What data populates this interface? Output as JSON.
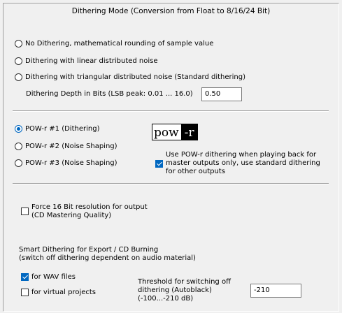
{
  "dithering": {
    "title": "Dithering Mode (Conversion from Float to 8/16/24 Bit)",
    "option_none": "No Dithering, mathematical rounding of sample value",
    "option_linear": "Dithering with linear distributed noise",
    "option_triangular": "Dithering with triangular distributed noise (Standard dithering)",
    "depth_label": "Dithering Depth in Bits (LSB peak: 0.01 ... 16.0)",
    "depth_value": "0.50",
    "selected": "none"
  },
  "powr": {
    "option_1": "POW-r #1  (Dithering)",
    "option_2": "POW-r #2  (Noise Shaping)",
    "option_3": "POW-r #3  (Noise Shaping)",
    "selected": "powr1",
    "logo_left": "pow",
    "logo_right": "-r",
    "master_only_line1": "Use POW-r dithering when playing back for",
    "master_only_line2": "master outputs only, use standard dithering",
    "master_only_line3": "for other outputs",
    "master_only_checked": true
  },
  "force16": {
    "line1": "Force 16 Bit resolution for output",
    "line2": "(CD Mastering Quality)",
    "checked": false
  },
  "smart": {
    "heading_line1": "Smart Dithering for Export / CD Burning",
    "heading_line2": "(switch off dithering dependent on audio material)",
    "wav_label": "for WAV files",
    "wav_checked": true,
    "virtual_label": "for virtual projects",
    "virtual_checked": false,
    "threshold_line1": "Threshold for switching off",
    "threshold_line2": "dithering (Autoblack)",
    "threshold_line3": "(-100...-210 dB)",
    "threshold_value": "-210"
  },
  "colors": {
    "background": "#f0f0f0",
    "accent": "#0067c0"
  }
}
